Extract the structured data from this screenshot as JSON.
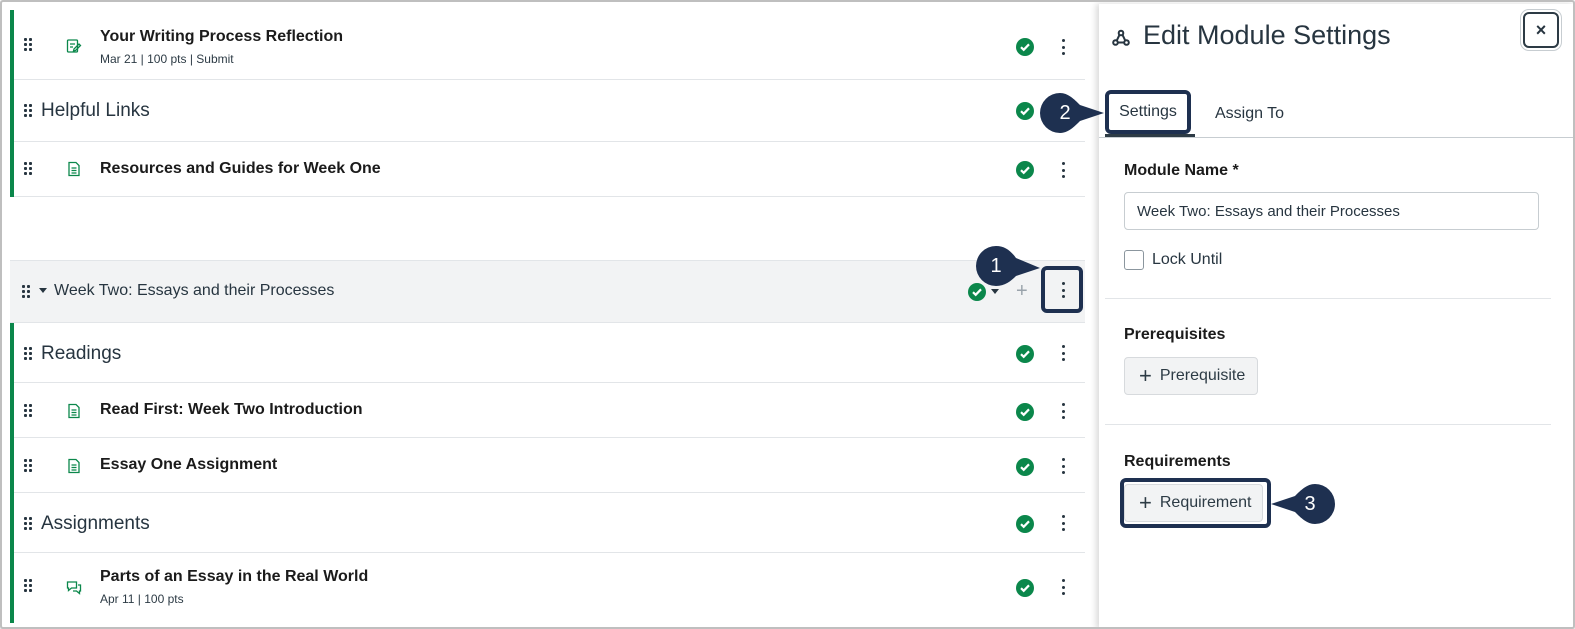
{
  "modules_list": {
    "week_one_items": [
      {
        "title": "Your Writing Process Reflection",
        "meta": "Mar 21  |  100 pts  |  Submit",
        "type_icon": "assignment-icon"
      },
      {
        "header": "Helpful Links"
      },
      {
        "title": "Resources and Guides for Week One",
        "type_icon": "page-icon"
      }
    ],
    "week_two": {
      "title": "Week Two: Essays and their Processes",
      "items": [
        {
          "header": "Readings"
        },
        {
          "title": "Read First: Week Two Introduction",
          "type_icon": "page-icon"
        },
        {
          "title": "Essay One Assignment",
          "type_icon": "page-icon"
        },
        {
          "header": "Assignments"
        },
        {
          "title": "Parts of an Essay in the Real World",
          "meta": "Apr 11  |  100 pts",
          "type_icon": "discussion-icon"
        }
      ]
    }
  },
  "callouts": [
    "1",
    "2",
    "3"
  ],
  "tray": {
    "title": "Edit Module Settings",
    "close_label": "×",
    "tabs": [
      "Settings",
      "Assign To"
    ],
    "module_name_label": "Module Name *",
    "module_name_value": "Week Two: Essays and their Processes",
    "lock_until_label": "Lock Until",
    "prerequisites_label": "Prerequisites",
    "add_prerequisite_label": "Prerequisite",
    "requirements_label": "Requirements",
    "add_requirement_label": "Requirement"
  },
  "colors": {
    "published_green": "#0b874b",
    "callout_navy": "#1e3050",
    "text": "#273540"
  }
}
